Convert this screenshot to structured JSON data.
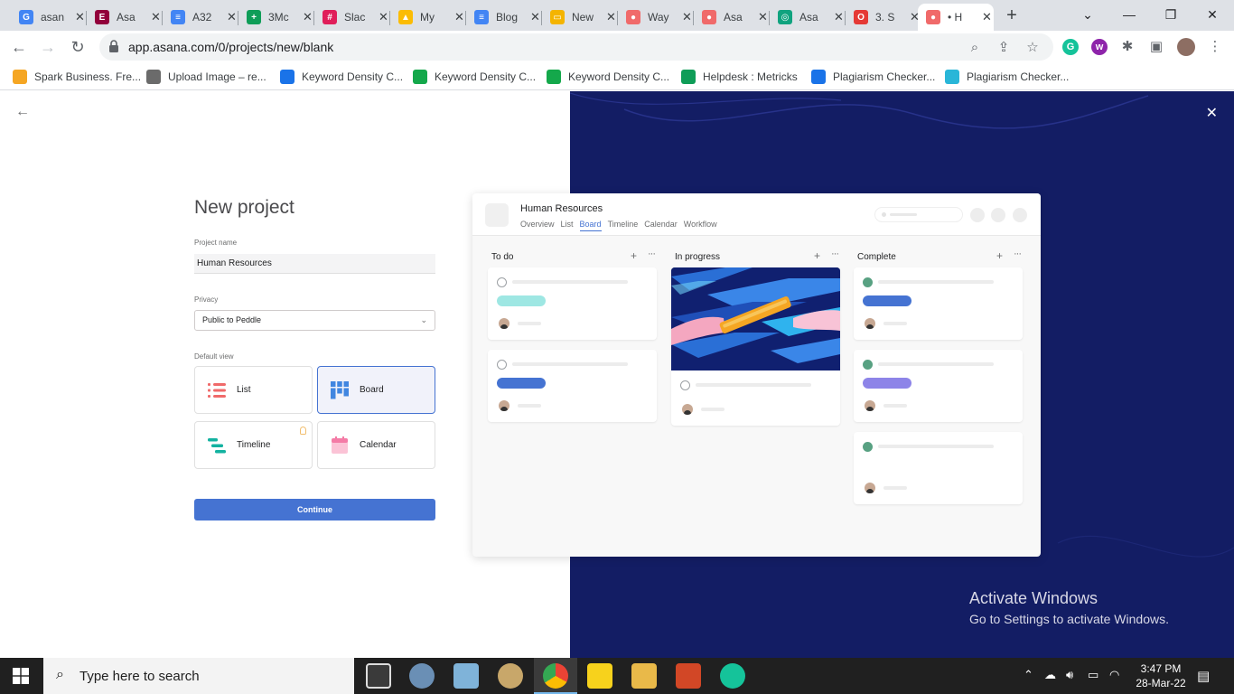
{
  "browser": {
    "tabs": [
      {
        "title": "asan",
        "color": "#4285f4",
        "glyph": "G"
      },
      {
        "title": "Asa",
        "color": "#92003b",
        "glyph": "E"
      },
      {
        "title": "A32",
        "color": "#4285f4",
        "glyph": "≡"
      },
      {
        "title": "3Mc",
        "color": "#0f9d58",
        "glyph": "+"
      },
      {
        "title": "Slac",
        "color": "#e01e5a",
        "glyph": "#"
      },
      {
        "title": "My",
        "color": "#fbbc04",
        "glyph": "▲"
      },
      {
        "title": "Blog",
        "color": "#4285f4",
        "glyph": "≡"
      },
      {
        "title": "New",
        "color": "#f4b400",
        "glyph": "▭"
      },
      {
        "title": "Way",
        "color": "#f06a6a",
        "glyph": "●"
      },
      {
        "title": "Asa",
        "color": "#f06a6a",
        "glyph": "●"
      },
      {
        "title": "Asa",
        "color": "#10a37f",
        "glyph": "◎"
      },
      {
        "title": "3. S",
        "color": "#e53935",
        "glyph": "O"
      },
      {
        "title": "• H",
        "color": "#f06a6a",
        "glyph": "●"
      }
    ],
    "close_glyph": "✕",
    "new_tab": "+",
    "window_controls": {
      "tab_search": "⌄",
      "minimize": "—",
      "maximize": "❐",
      "close": "✕"
    },
    "url": "app.asana.com/0/projects/new/blank",
    "bookmarks": [
      {
        "label": "Spark Business. Fre...",
        "color": "#f5a623"
      },
      {
        "label": "Upload Image – re...",
        "color": "#6b6b6b"
      },
      {
        "label": "Keyword Density C...",
        "color": "#1a73e8"
      },
      {
        "label": "Keyword Density C...",
        "color": "#14a84b"
      },
      {
        "label": "Keyword Density C...",
        "color": "#14a84b"
      },
      {
        "label": "Helpdesk : Metricks",
        "color": "#0f9d58"
      },
      {
        "label": "Plagiarism Checker...",
        "color": "#1a73e8"
      },
      {
        "label": "Plagiarism Checker...",
        "color": "#29b6d8"
      }
    ]
  },
  "form": {
    "title": "New project",
    "project_name_label": "Project name",
    "project_name_value": "Human Resources",
    "privacy_label": "Privacy",
    "privacy_value": "Public to Peddle",
    "default_view_label": "Default view",
    "views": [
      {
        "label": "List",
        "selected": false
      },
      {
        "label": "Board",
        "selected": true
      },
      {
        "label": "Timeline",
        "selected": false
      },
      {
        "label": "Calendar",
        "selected": false
      }
    ],
    "continue_label": "Continue"
  },
  "preview": {
    "project_title": "Human Resources",
    "tabs": [
      "Overview",
      "List",
      "Board",
      "Timeline",
      "Calendar",
      "Workflow"
    ],
    "active_tab": "Board",
    "columns": [
      {
        "title": "To do"
      },
      {
        "title": "In progress"
      },
      {
        "title": "Complete"
      }
    ],
    "plus_glyph": "+",
    "more_glyph": "···",
    "colors": {
      "teal": "#9ee7e3",
      "blue": "#4573d2",
      "purple": "#8d84e8",
      "done": "#58a182"
    }
  },
  "watermark": {
    "line1": "Activate Windows",
    "line2": "Go to Settings to activate Windows."
  },
  "taskbar": {
    "search_placeholder": "Type here to search",
    "time": "3:47 PM",
    "date": "28-Mar-22"
  }
}
